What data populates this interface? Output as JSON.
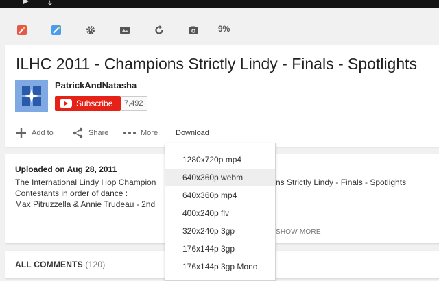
{
  "extension_toolbar": {
    "icons": [
      "red-wand-icon",
      "blue-wand-icon",
      "gear-icon",
      "image-icon",
      "refresh-icon",
      "camera-icon"
    ],
    "percent": "9%"
  },
  "video": {
    "title": "ILHC 2011 - Champions Strictly Lindy - Finals - Spotlights",
    "channel": "PatrickAndNatasha",
    "subscribe_label": "Subscribe",
    "subscriber_count": "7,492"
  },
  "actions": {
    "add_to": "Add to",
    "share": "Share",
    "more": "More",
    "download": "Download"
  },
  "description": {
    "uploaded": "Uploaded on Aug 28, 2011",
    "line1_left": "The International Lindy Hop Champion",
    "line1_right": "ns Strictly Lindy - Finals - Spotlights",
    "line2": "Contestants in order of dance :",
    "line3": "Max Pitruzzella & Annie Trudeau - 2nd",
    "show_more": "SHOW MORE"
  },
  "comments": {
    "label": "ALL COMMENTS",
    "count": "(120)"
  },
  "download_menu": {
    "items": [
      "1280x720p mp4",
      "640x360p webm",
      "640x360p mp4",
      "400x240p flv",
      "320x240p 3gp",
      "176x144p 3gp",
      "176x144p 3gp Mono"
    ],
    "highlighted": "640x360p webm"
  },
  "colors": {
    "subscribe_red": "#e62117",
    "avatar_blue": "#7fa9e3",
    "page_background": "#f1f1f1"
  }
}
